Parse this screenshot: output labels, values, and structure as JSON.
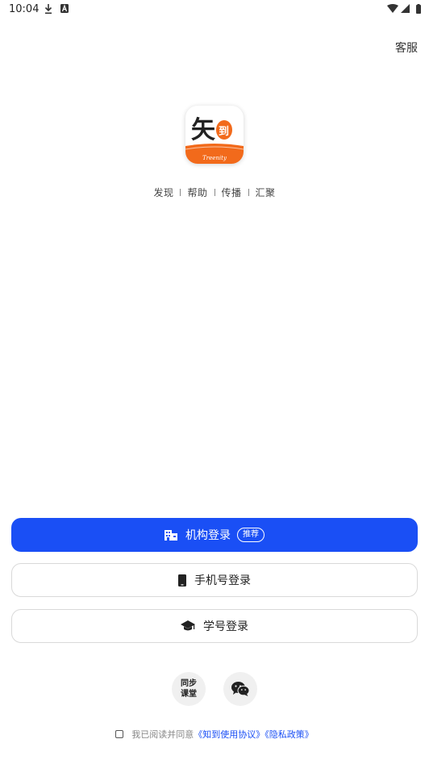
{
  "status_bar": {
    "time": "10:04"
  },
  "header": {
    "service_label": "客服"
  },
  "brand": {
    "logo_text": "Treenity",
    "tags": [
      "发现",
      "帮助",
      "传播",
      "汇聚"
    ]
  },
  "buttons": {
    "org_login": {
      "label": "机构登录",
      "badge": "推荐"
    },
    "phone_login": {
      "label": "手机号登录"
    },
    "student_login": {
      "label": "学号登录"
    }
  },
  "third_party": {
    "sync_class": {
      "line1": "同步",
      "line2": "课堂"
    },
    "wechat_icon": "wechat-icon"
  },
  "agreement": {
    "prefix": "我已阅读并同意",
    "terms": "《知到使用协议》",
    "privacy": "《隐私政策》",
    "checked": false
  },
  "colors": {
    "primary": "#1a4ff5",
    "logo_orange": "#f26a1b"
  }
}
